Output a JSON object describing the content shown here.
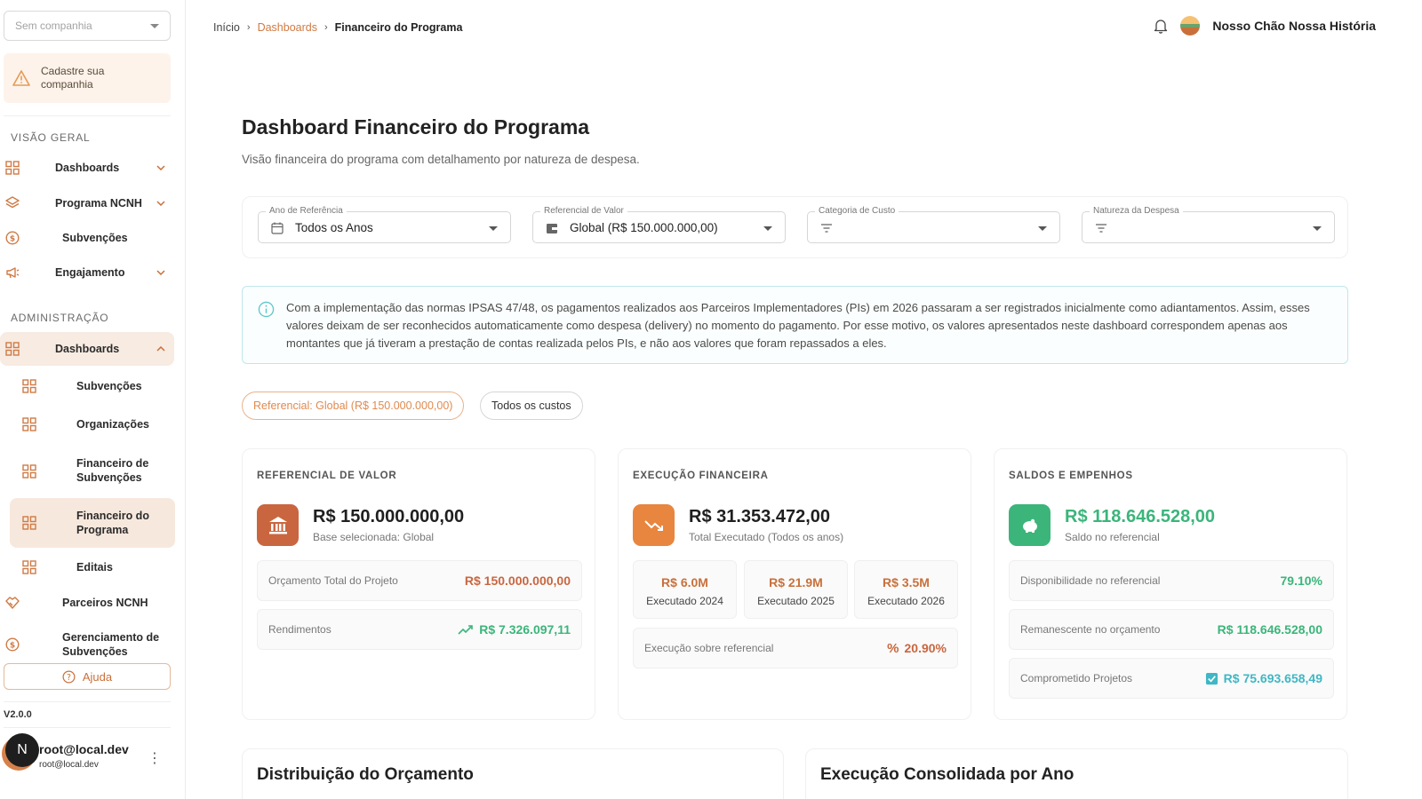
{
  "sidebar": {
    "company_select_placeholder": "Sem companhia",
    "warning_text": "Cadastre sua companhia",
    "section_overview": "VISÃO GERAL",
    "section_admin": "ADMINISTRAÇÃO",
    "overview_items": [
      {
        "label": "Dashboards",
        "icon": "grid-icon"
      },
      {
        "label": "Programa NCNH",
        "icon": "layers-icon"
      },
      {
        "label": "Subvenções",
        "icon": "coin-icon"
      },
      {
        "label": "Engajamento",
        "icon": "megaphone-icon"
      }
    ],
    "admin_items": [
      {
        "label": "Dashboards",
        "icon": "grid-icon"
      },
      {
        "label": "Subvenções",
        "icon": "grid-icon"
      },
      {
        "label": "Organizações",
        "icon": "grid-icon"
      },
      {
        "label": "Financeiro de Subvenções",
        "icon": "grid-icon"
      },
      {
        "label": "Financeiro do Programa",
        "icon": "grid-icon"
      },
      {
        "label": "Editais",
        "icon": "grid-icon"
      },
      {
        "label": "Parceiros NCNH",
        "icon": "handshake-icon"
      },
      {
        "label": "Gerenciamento de Subvenções",
        "icon": "coin-icon"
      }
    ],
    "help_label": "Ajuda",
    "version": "V2.0.0",
    "user": {
      "initial": "N",
      "name": "root@local.dev",
      "email": "root@local.dev"
    }
  },
  "header": {
    "breadcrumb": {
      "home": "Início",
      "dashboards": "Dashboards",
      "current": "Financeiro do Programa"
    },
    "org_name": "Nosso Chão Nossa História"
  },
  "main": {
    "title": "Dashboard Financeiro do Programa",
    "subtitle": "Visão financeira do programa com detalhamento por natureza de despesa.",
    "filters": [
      {
        "label": "Ano de Referência",
        "value": "Todos os Anos",
        "icon": "calendar-icon"
      },
      {
        "label": "Referencial de Valor",
        "value": "Global (R$ 150.000.000,00)",
        "icon": "wallet-icon"
      },
      {
        "label": "Categoria de Custo",
        "value": "",
        "icon": "filter-icon"
      },
      {
        "label": "Natureza da Despesa",
        "value": "",
        "icon": "filter-icon"
      }
    ],
    "info_text": "Com a implementação das normas IPSAS 47/48, os pagamentos realizados aos Parceiros Implementadores (PIs) em 2026 passaram a ser registrados inicialmente como adiantamentos. Assim, esses valores deixam de ser reconhecidos automaticamente como despesa (delivery) no momento do pagamento. Por esse motivo, os valores apresentados neste dashboard correspondem apenas aos montantes que já tiveram a prestação de contas realizada pelos PIs, e não aos valores que foram repassados a eles.",
    "chips": {
      "referencial": "Referencial: Global (R$ 150.000.000,00)",
      "costs": "Todos os custos"
    },
    "card_referencial": {
      "title": "REFERENCIAL DE VALOR",
      "value": "R$ 150.000.000,00",
      "sub": "Base selecionada: Global",
      "rows": [
        {
          "label": "Orçamento Total do Projeto",
          "value": "R$ 150.000.000,00"
        },
        {
          "label": "Rendimentos",
          "value": "R$ 7.326.097,11"
        }
      ]
    },
    "card_execucao": {
      "title": "EXECUÇÃO FINANCEIRA",
      "value": "R$ 31.353.472,00",
      "sub": "Total Executado (Todos os anos)",
      "years": [
        {
          "value": "R$ 6.0M",
          "label": "Executado 2024"
        },
        {
          "value": "R$ 21.9M",
          "label": "Executado 2025"
        },
        {
          "value": "R$ 3.5M",
          "label": "Executado 2026"
        }
      ],
      "row": {
        "label": "Execução sobre referencial",
        "value": "20.90%"
      }
    },
    "card_saldos": {
      "title": "SALDOS E EMPENHOS",
      "value": "R$ 118.646.528,00",
      "sub": "Saldo no referencial",
      "rows": [
        {
          "label": "Disponibilidade no referencial",
          "value": "79.10%"
        },
        {
          "label": "Remanescente no orçamento",
          "value": "R$ 118.646.528,00"
        },
        {
          "label": "Comprometido Projetos",
          "value": "R$ 75.693.658,49"
        }
      ]
    },
    "bottom_titles": {
      "left": "Distribuição do Orçamento",
      "right": "Execução Consolidada por Ano"
    }
  },
  "colors": {
    "accent": "#c9703a",
    "green": "#3bb57a",
    "info_border": "#bfe8ea"
  }
}
